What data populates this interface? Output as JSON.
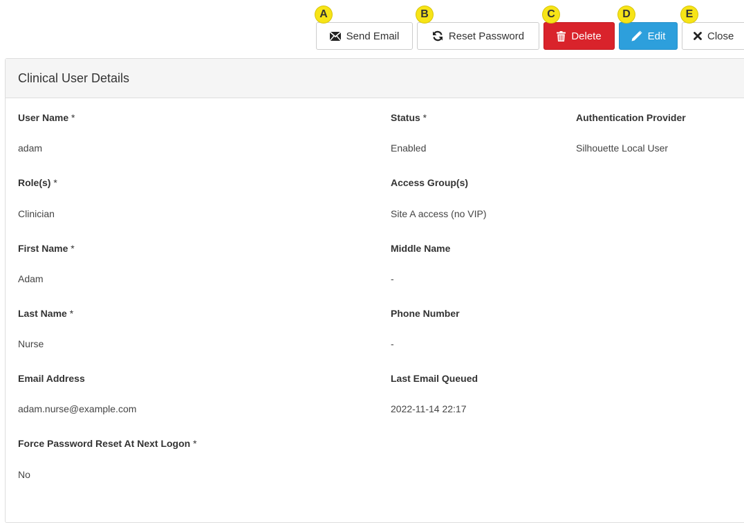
{
  "toolbar": {
    "buttons": [
      {
        "badge": "A",
        "label": "Send Email",
        "icon": "envelope-icon"
      },
      {
        "badge": "B",
        "label": "Reset Password",
        "icon": "refresh-icon"
      },
      {
        "badge": "C",
        "label": "Delete",
        "icon": "trash-icon"
      },
      {
        "badge": "D",
        "label": "Edit",
        "icon": "pencil-icon"
      },
      {
        "badge": "E",
        "label": "Close",
        "icon": "close-icon"
      }
    ]
  },
  "panel": {
    "title": "Clinical User Details"
  },
  "fields": {
    "user_name": {
      "label": "User Name",
      "required": " *",
      "value": "adam"
    },
    "status": {
      "label": "Status",
      "required": " *",
      "value": "Enabled"
    },
    "auth_provider": {
      "label": "Authentication Provider",
      "value": "Silhouette Local User"
    },
    "roles": {
      "label": "Role(s)",
      "required": " *",
      "value": "Clinician"
    },
    "access_groups": {
      "label": "Access Group(s)",
      "value": "Site A access (no VIP)"
    },
    "first_name": {
      "label": "First Name",
      "required": " *",
      "value": "Adam"
    },
    "middle_name": {
      "label": "Middle Name",
      "value": "-"
    },
    "last_name": {
      "label": "Last Name",
      "required": " *",
      "value": "Nurse"
    },
    "phone_number": {
      "label": "Phone Number",
      "value": "-"
    },
    "email_address": {
      "label": "Email Address",
      "value": "adam.nurse@example.com"
    },
    "last_email_queued": {
      "label": "Last Email Queued",
      "value": "2022-11-14 22:17"
    },
    "force_password_reset": {
      "label": "Force Password Reset At Next Logon",
      "required": " *",
      "value": "No"
    }
  },
  "colors": {
    "delete": "#d9232b",
    "edit": "#2d9fdc",
    "badge": "#f7e417"
  }
}
